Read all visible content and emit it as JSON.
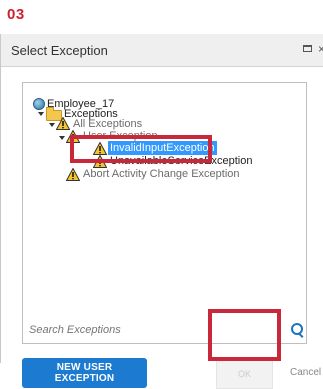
{
  "step": "03",
  "dialog": {
    "title": "Select Exception",
    "tree": {
      "root": "Employee_17",
      "folder": "Exceptions",
      "all": "All Exceptions",
      "user": "User Exception",
      "selected": "InvalidInputException",
      "unavailable": "UnavailableServiceException",
      "abort": "Abort Activity Change Exception"
    },
    "search_placeholder": "Search Exceptions",
    "buttons": {
      "new_user_exception": "NEW USER EXCEPTION",
      "ok": "OK",
      "cancel": "Cancel"
    }
  },
  "colors": {
    "step_red": "#d0202f",
    "highlight_red": "#c9273a",
    "primary_blue": "#1c7bd0",
    "selection_blue": "#3399ff"
  }
}
